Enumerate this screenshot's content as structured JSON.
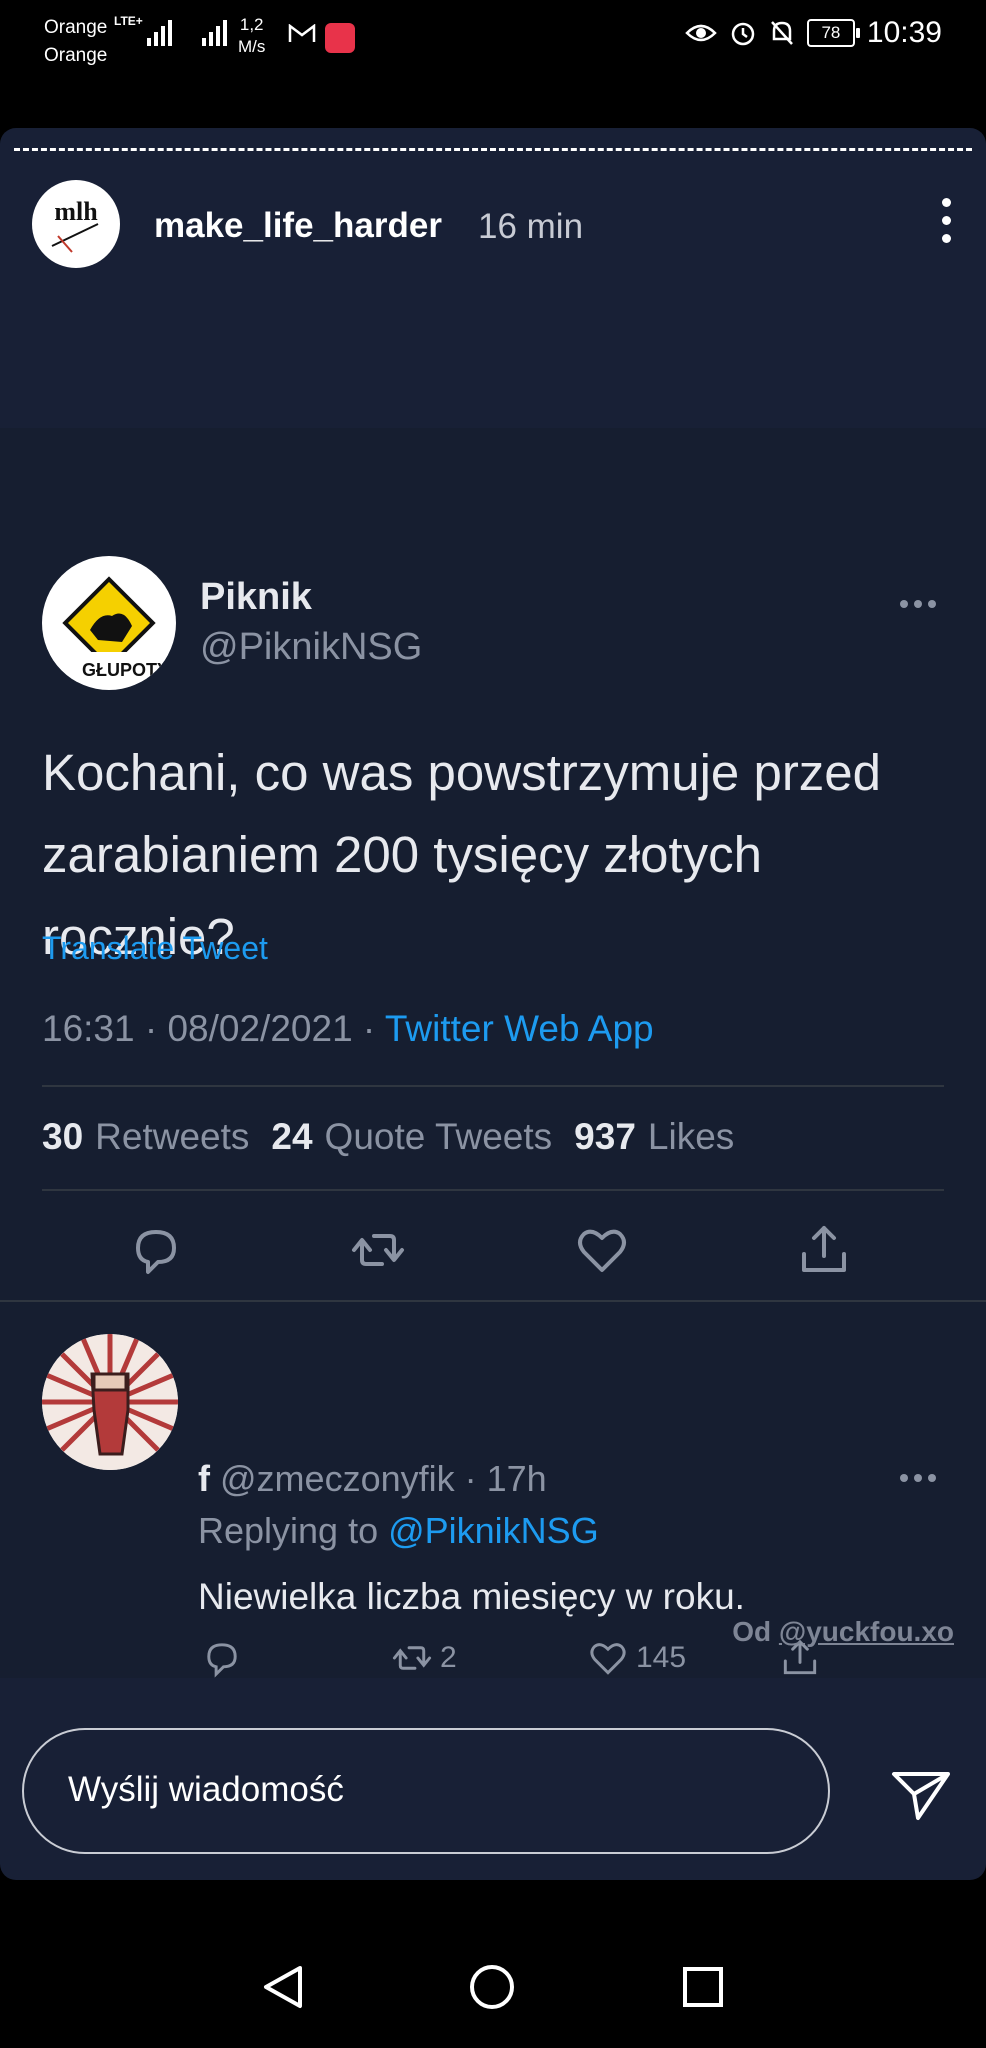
{
  "status_bar": {
    "carrier_1": "Orange",
    "carrier_2": "Orange",
    "network_type": "LTE+",
    "speed_value": "1,2",
    "speed_unit": "M/s",
    "battery": "78",
    "time": "10:39"
  },
  "story": {
    "username": "make_life_harder",
    "time_ago": "16 min",
    "avatar_text": "mlh"
  },
  "tweet": {
    "author_name": "Piknik",
    "author_handle": "@PiknikNSG",
    "text": "Kochani, co was powstrzymuje przed zarabianiem 200 tysięcy złotych rocznie?",
    "translate_label": "Translate Tweet",
    "timestamp": "16:31 · 08/02/2021 · ",
    "source": "Twitter Web App",
    "retweets_count": "30",
    "retweets_label": "Retweets",
    "quote_count": "24",
    "quote_label": "Quote Tweets",
    "likes_count": "937",
    "likes_label": "Likes"
  },
  "reply": {
    "name": "f",
    "handle": "@zmeczonyfik",
    "time": "· 17h",
    "replying_prefix": "Replying to ",
    "replying_to": "@PiknikNSG",
    "text": "Niewielka liczba miesięcy w roku.",
    "retweets": "2",
    "likes": "145"
  },
  "attribution": {
    "prefix": "Od ",
    "handle": "@yuckfou.xo"
  },
  "message_input": {
    "placeholder": "Wyślij wiadomość"
  },
  "colors": {
    "twitter_blue": "#1d9bf0",
    "story_bg": "#182036",
    "tweet_bg": "#161e30"
  }
}
